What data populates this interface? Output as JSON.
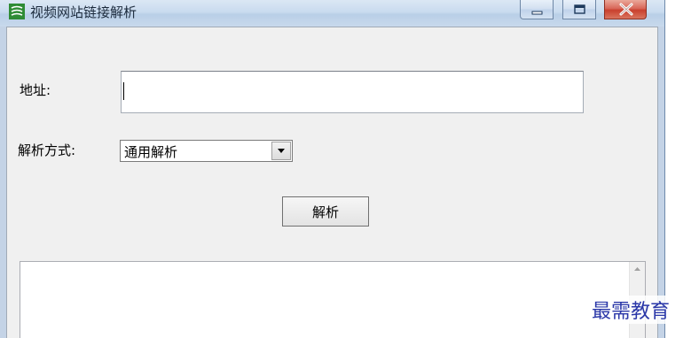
{
  "window": {
    "title": "视频网站链接解析",
    "icon": "app-logo-icon",
    "controls": {
      "minimize_icon": "minimize-icon",
      "maximize_icon": "maximize-icon",
      "close_icon": "close-icon"
    }
  },
  "form": {
    "address_label": "地址:",
    "address_value": "",
    "mode_label": "解析方式:",
    "mode_selected": "通用解析",
    "parse_button_label": "解析"
  },
  "output": {
    "value": ""
  },
  "watermark": {
    "text": "最需教育"
  },
  "colors": {
    "close_button": "#c9402e",
    "watermark_text": "#2a37a8"
  }
}
